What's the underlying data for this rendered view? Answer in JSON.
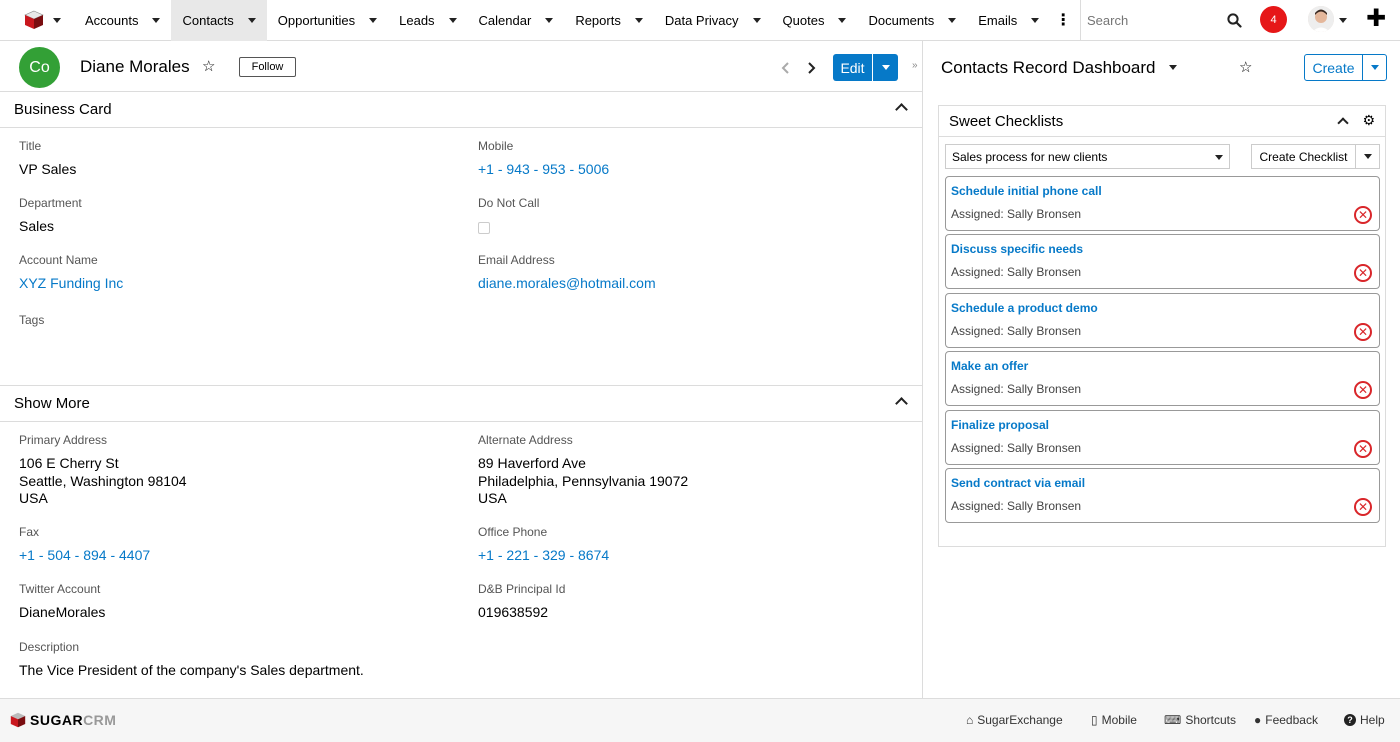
{
  "nav": {
    "items": [
      {
        "label": "Accounts",
        "dropdown": true
      },
      {
        "label": "Contacts",
        "dropdown": true,
        "active": true
      },
      {
        "label": "Opportunities",
        "dropdown": true
      },
      {
        "label": "Leads",
        "dropdown": true
      },
      {
        "label": "Calendar",
        "dropdown": true
      },
      {
        "label": "Reports",
        "dropdown": true
      },
      {
        "label": "Data Privacy",
        "dropdown": true
      },
      {
        "label": "Quotes",
        "dropdown": true
      },
      {
        "label": "Documents",
        "dropdown": true
      },
      {
        "label": "Emails",
        "dropdown": true
      }
    ],
    "more_icon": "more-vertical-icon",
    "search_placeholder": "Search",
    "notification_count": "4",
    "plus_icon": "plus-icon"
  },
  "record": {
    "avatar_initials": "Co",
    "name": "Diane Morales",
    "follow_label": "Follow",
    "edit_label": "Edit"
  },
  "business_card": {
    "heading": "Business Card",
    "title": {
      "label": "Title",
      "value": "VP Sales"
    },
    "mobile": {
      "label": "Mobile",
      "value": "+1 - 943 - 953 - 5006"
    },
    "department": {
      "label": "Department",
      "value": "Sales"
    },
    "do_not_call": {
      "label": "Do Not Call",
      "checked": false
    },
    "account_name": {
      "label": "Account Name",
      "value": "XYZ Funding Inc"
    },
    "email": {
      "label": "Email Address",
      "value": "diane.morales@hotmail.com"
    },
    "tags": {
      "label": "Tags",
      "value": ""
    }
  },
  "show_more": {
    "heading": "Show More",
    "primary_address": {
      "label": "Primary Address",
      "line1": "106 E Cherry St",
      "line2": "Seattle, Washington 98104",
      "line3": "USA"
    },
    "alternate_address": {
      "label": "Alternate Address",
      "line1": "89 Haverford Ave",
      "line2": "Philadelphia, Pennsylvania 19072",
      "line3": "USA"
    },
    "fax": {
      "label": "Fax",
      "value": "+1 - 504 - 894 - 4407"
    },
    "office_phone": {
      "label": "Office Phone",
      "value": "+1 - 221 - 329 - 8674"
    },
    "twitter": {
      "label": "Twitter Account",
      "value": "DianeMorales"
    },
    "dnb": {
      "label": "D&B Principal Id",
      "value": "019638592"
    },
    "description": {
      "label": "Description",
      "value": "The Vice President of the company's Sales department."
    }
  },
  "dashboard": {
    "title": "Contacts Record Dashboard",
    "create_label": "Create",
    "dashlet": {
      "title": "Sweet Checklists",
      "select_value": "Sales process for new clients",
      "create_checklist_label": "Create Checklist",
      "tasks": [
        {
          "title": "Schedule initial phone call",
          "assigned": "Assigned: Sally Bronsen"
        },
        {
          "title": "Discuss specific needs",
          "assigned": "Assigned: Sally Bronsen"
        },
        {
          "title": "Schedule a product demo",
          "assigned": "Assigned: Sally Bronsen"
        },
        {
          "title": "Make an offer",
          "assigned": "Assigned: Sally Bronsen"
        },
        {
          "title": "Finalize proposal",
          "assigned": "Assigned: Sally Bronsen"
        },
        {
          "title": "Send contract via email",
          "assigned": "Assigned: Sally Bronsen"
        }
      ]
    }
  },
  "footer": {
    "logo_part1": "SUGAR",
    "logo_part2": "CRM",
    "links": [
      {
        "label": "SugarExchange",
        "icon": "store-icon"
      },
      {
        "label": "Mobile",
        "icon": "mobile-icon"
      },
      {
        "label": "Shortcuts",
        "icon": "keyboard-icon"
      },
      {
        "label": "Feedback",
        "icon": "comment-icon"
      },
      {
        "label": "Help",
        "icon": "help-icon"
      }
    ]
  },
  "colors": {
    "accent": "#0679c8",
    "avatar_green": "#33a036",
    "notification_red": "#e61718",
    "delete_red": "#d9262a"
  }
}
